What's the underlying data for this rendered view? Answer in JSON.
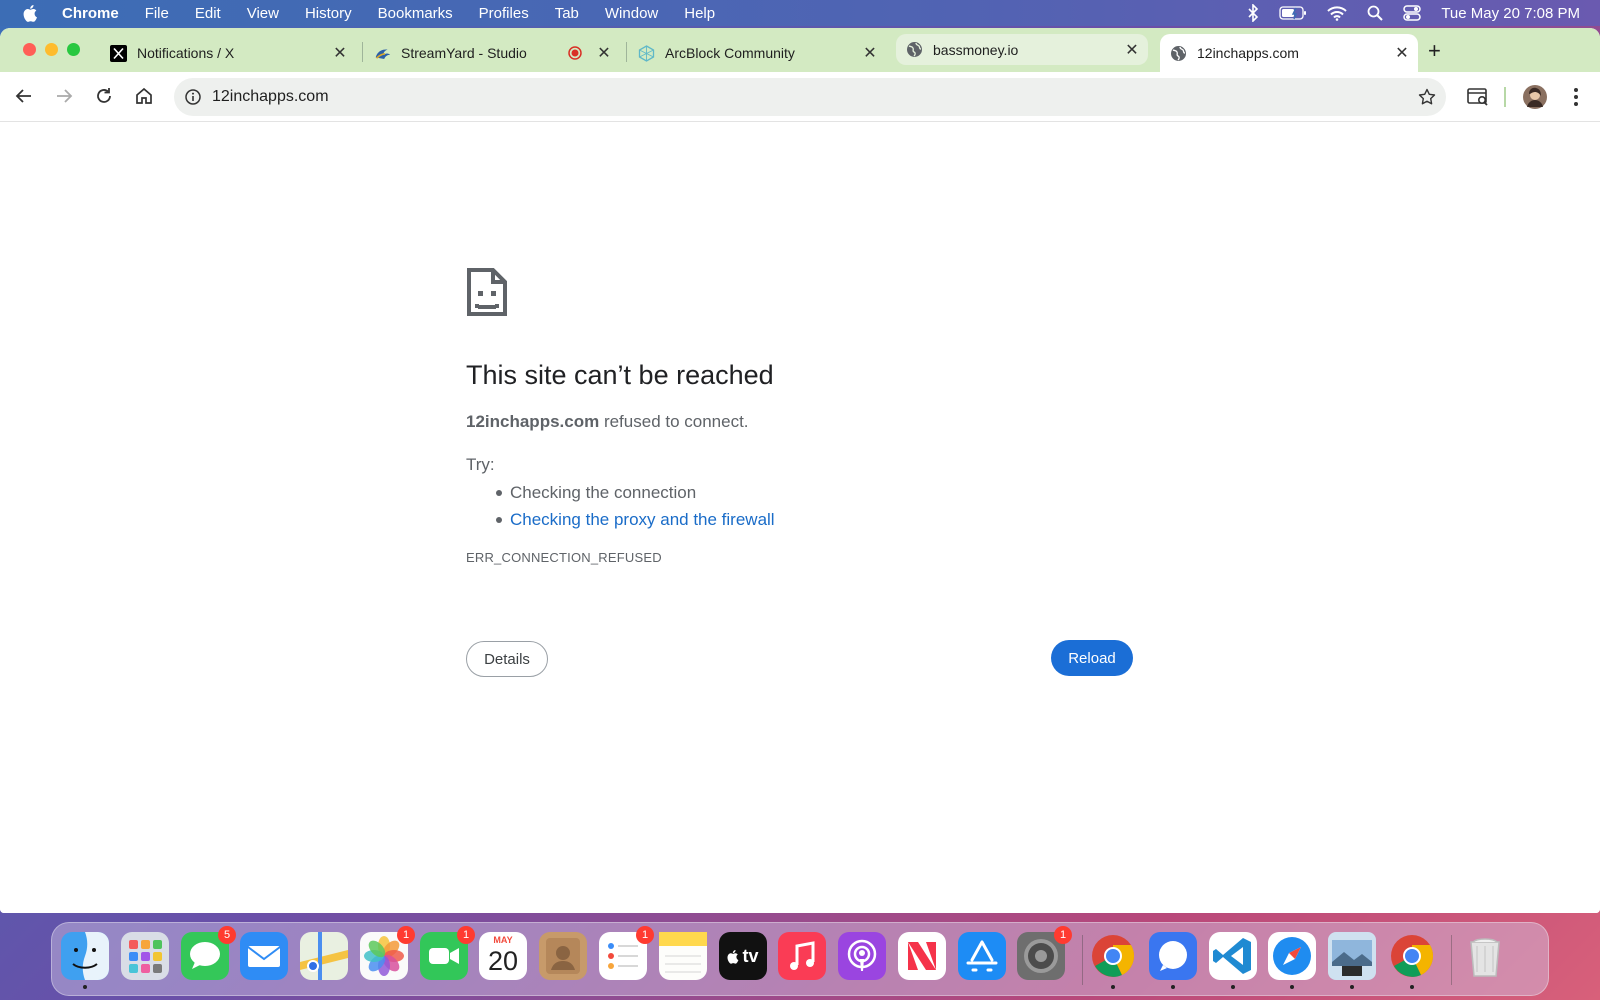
{
  "menubar": {
    "app_name": "Chrome",
    "items": [
      "File",
      "Edit",
      "View",
      "History",
      "Bookmarks",
      "Profiles",
      "Tab",
      "Window",
      "Help"
    ],
    "clock": "Tue May 20  7:08 PM",
    "status_icons": [
      "bluetooth-icon",
      "battery-icon",
      "wifi-icon",
      "spotlight-icon",
      "control-center-icon"
    ]
  },
  "tabs": [
    {
      "title": "Notifications / X",
      "icon": "x-logo-icon"
    },
    {
      "title": "StreamYard - Studio",
      "icon": "streamyard-icon",
      "recording": true
    },
    {
      "title": "ArcBlock Community",
      "icon": "arcblock-icon"
    },
    {
      "title": "bassmoney.io",
      "icon": "globe-icon"
    },
    {
      "title": "12inchapps.com",
      "icon": "globe-icon",
      "active": true
    }
  ],
  "toolbar": {
    "url": "12inchapps.com"
  },
  "error": {
    "title": "This site can’t be reached",
    "host": "12inchapps.com",
    "desc_suffix": " refused to connect.",
    "try_label": "Try:",
    "suggestions": [
      "Checking the connection",
      "Checking the proxy and the firewall"
    ],
    "code": "ERR_CONNECTION_REFUSED",
    "details_label": "Details",
    "reload_label": "Reload"
  },
  "dock": {
    "apps": [
      {
        "name": "Finder",
        "icon": "finder-icon",
        "color": "#3fa0f0",
        "running": true
      },
      {
        "name": "Launchpad",
        "icon": "launchpad-icon",
        "color": "#b9c3d3"
      },
      {
        "name": "Messages",
        "icon": "messages-icon",
        "color": "#34c759",
        "badge": "5"
      },
      {
        "name": "Mail",
        "icon": "mail-icon",
        "color": "#2f8cf5"
      },
      {
        "name": "Maps",
        "icon": "maps-icon",
        "color": "#7ccf6c"
      },
      {
        "name": "Photos",
        "icon": "photos-icon",
        "color": "#f6f6f6",
        "badge": "1"
      },
      {
        "name": "FaceTime",
        "icon": "facetime-icon",
        "color": "#32c759",
        "badge": "1"
      },
      {
        "name": "Calendar",
        "icon": "calendar-icon",
        "color": "#ffffff",
        "month": "MAY",
        "day": "20"
      },
      {
        "name": "Contacts",
        "icon": "contacts-icon",
        "color": "#c79a6a"
      },
      {
        "name": "Reminders",
        "icon": "reminders-icon",
        "color": "#ffffff",
        "badge": "1"
      },
      {
        "name": "Notes",
        "icon": "notes-icon",
        "color": "#ffd84d"
      },
      {
        "name": "Apple TV",
        "icon": "apple-tv-icon",
        "color": "#111111",
        "label": "tv"
      },
      {
        "name": "Music",
        "icon": "music-icon",
        "color": "#fa3c55"
      },
      {
        "name": "Podcasts",
        "icon": "podcasts-icon",
        "color": "#9a45e0"
      },
      {
        "name": "News",
        "icon": "news-icon",
        "color": "#ffffff"
      },
      {
        "name": "App Store",
        "icon": "app-store-icon",
        "color": "#1d8cf5"
      },
      {
        "name": "System Settings",
        "icon": "system-settings-icon",
        "color": "#7a7a7a",
        "badge": "1"
      },
      {
        "name": "Google Chrome",
        "icon": "chrome-icon",
        "color": "#ffffff",
        "running": true
      },
      {
        "name": "Signal",
        "icon": "signal-icon",
        "color": "#3a76f0",
        "running": true
      },
      {
        "name": "Visual Studio Code",
        "icon": "vscode-icon",
        "color": "#ffffff",
        "running": true
      },
      {
        "name": "Safari",
        "icon": "safari-icon",
        "color": "#ffffff",
        "running": true
      },
      {
        "name": "Preview",
        "icon": "preview-icon",
        "color": "#9cc0e0",
        "running": true
      },
      {
        "name": "Google Chrome (2)",
        "icon": "chrome-icon",
        "color": "#ffffff",
        "running": true
      },
      {
        "name": "Trash",
        "icon": "trash-icon",
        "color": "#e6e6e6"
      }
    ]
  },
  "colors": {
    "tabstrip": "#d3eac2",
    "reload_button": "#1b6ed6",
    "link": "#1a6cc8"
  }
}
